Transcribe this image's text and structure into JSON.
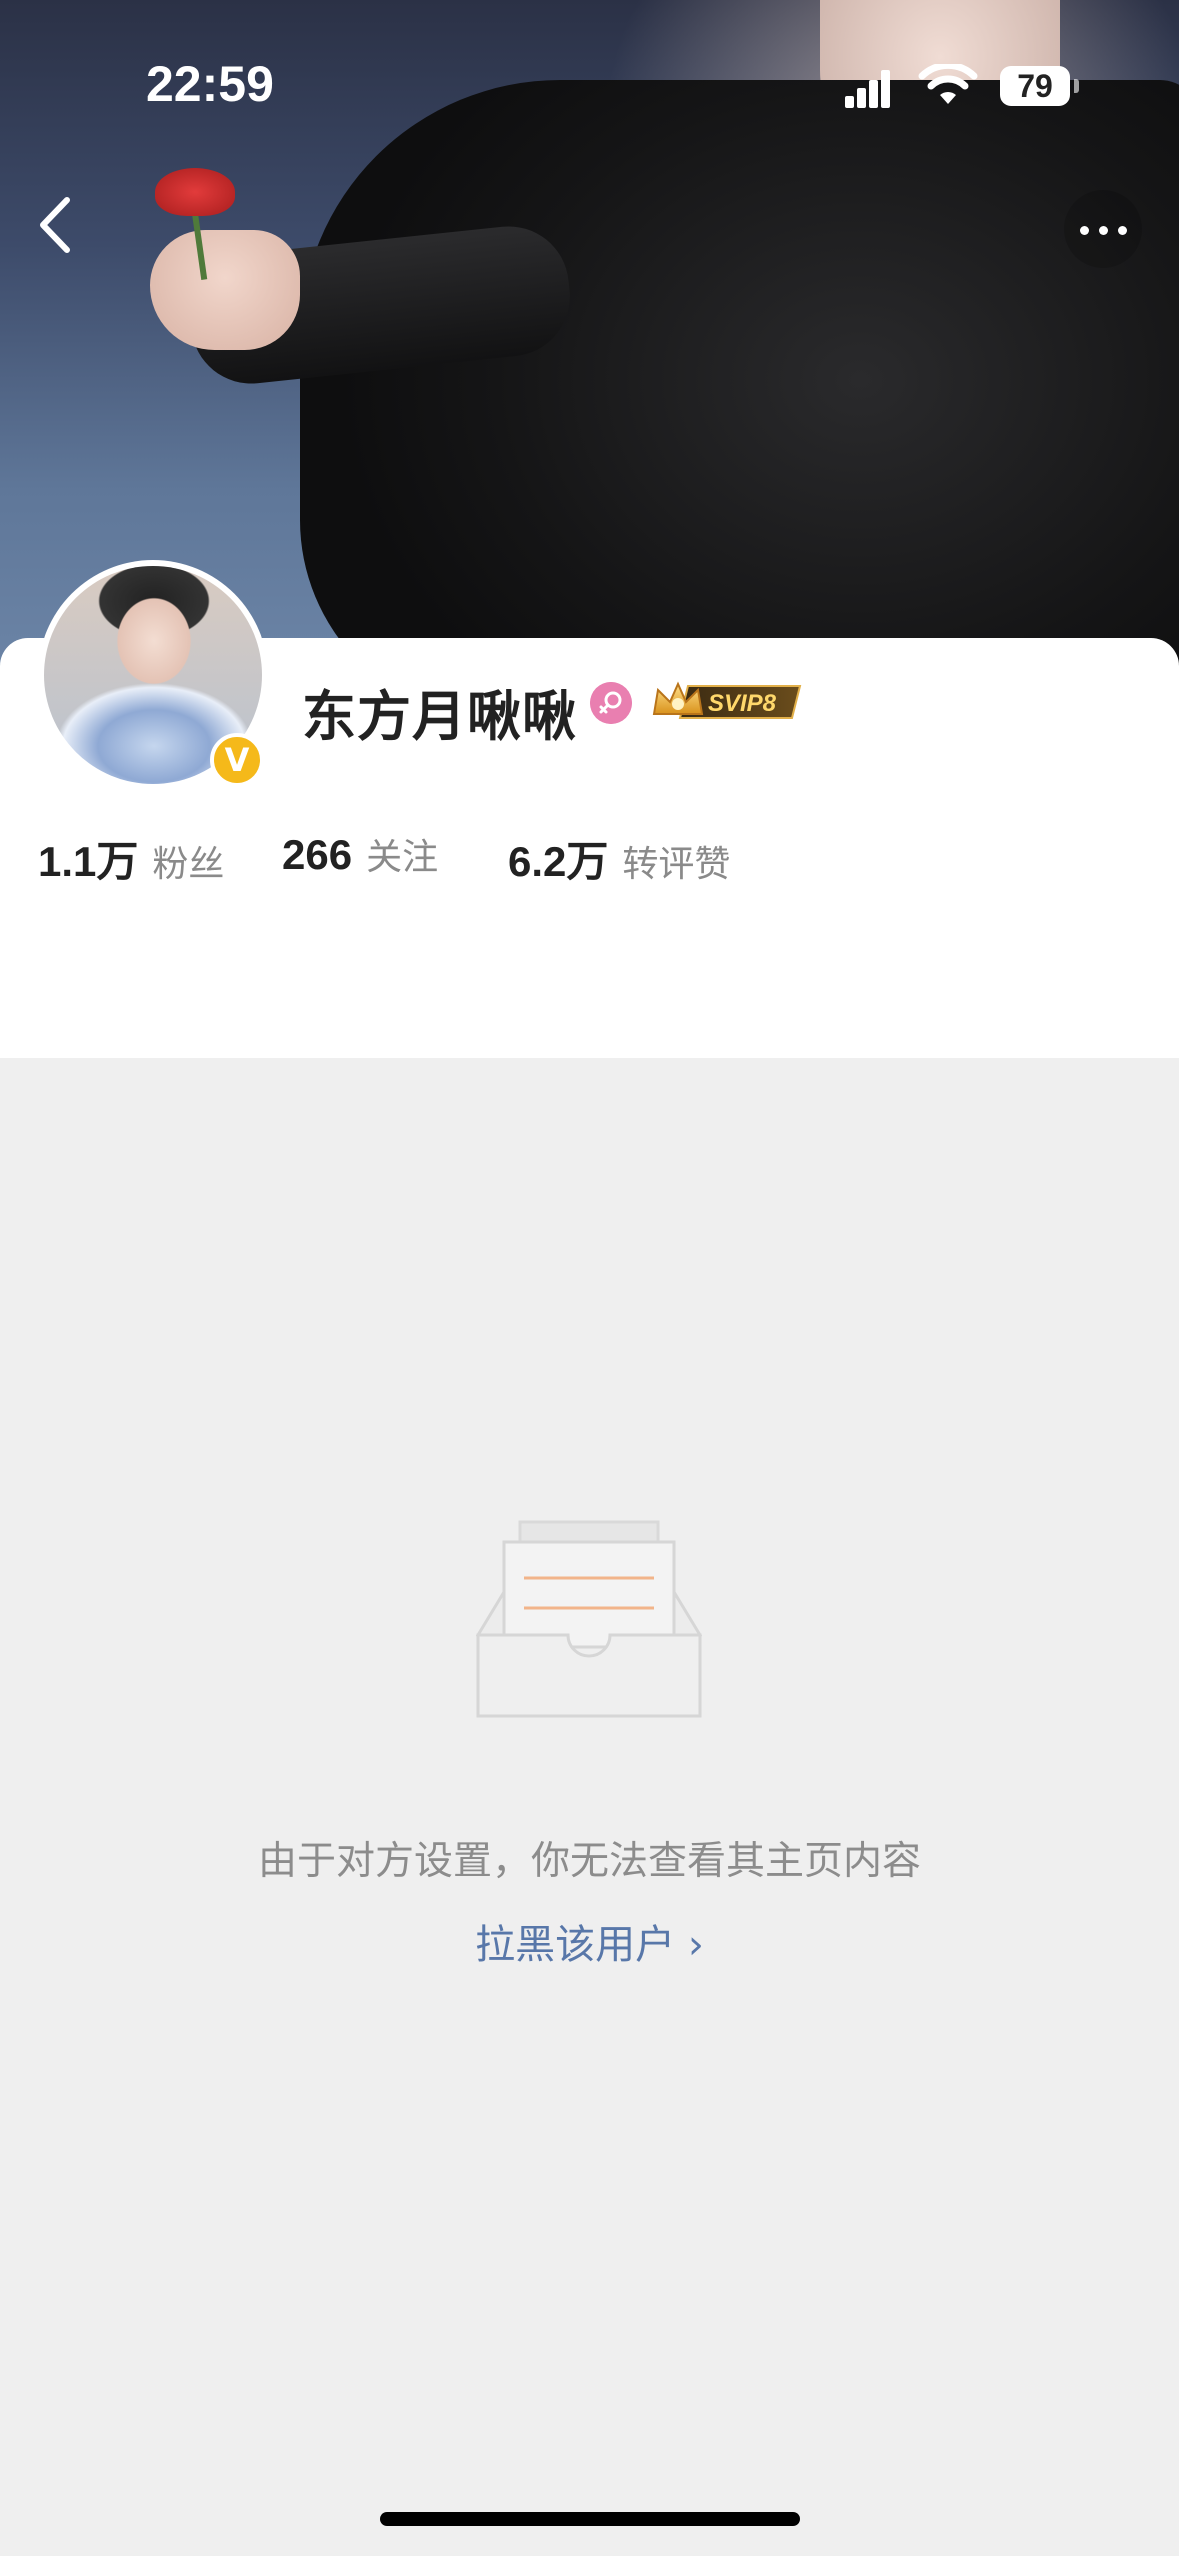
{
  "status_bar": {
    "time": "22:59",
    "battery": "79"
  },
  "profile": {
    "username": "东方月啾啾",
    "vip_label": "SVIP8",
    "verified_mark": "V",
    "stats": [
      {
        "number": "1.1万",
        "label": "粉丝"
      },
      {
        "number": "266",
        "label": "关注"
      },
      {
        "number": "6.2万",
        "label": "转评赞"
      }
    ]
  },
  "empty_state": {
    "message": "由于对方设置，你无法查看其主页内容",
    "block_link": "拉黑该用户 ›"
  },
  "icons": {
    "back": "back-arrow-icon",
    "more": "more-dots-icon",
    "gender": "female-icon",
    "verified": "verified-badge-icon"
  },
  "colors": {
    "link": "#5877a9",
    "verified": "#f5b91a",
    "gender": "#e97fb0",
    "background": "#efefef"
  }
}
